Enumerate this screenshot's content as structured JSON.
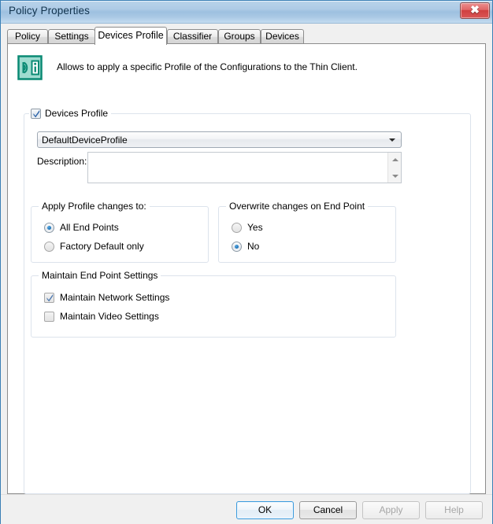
{
  "window": {
    "title": "Policy Properties",
    "close_label": "✕"
  },
  "tabs": [
    {
      "label": "Policy",
      "active": false
    },
    {
      "label": "Settings",
      "active": false
    },
    {
      "label": "Devices Profile",
      "active": true
    },
    {
      "label": "Classifier",
      "active": false
    },
    {
      "label": "Groups",
      "active": false
    },
    {
      "label": "Devices",
      "active": false
    }
  ],
  "header": {
    "icon": "thin-client-device-icon",
    "description": "Allows to apply a specific Profile of the Configurations to the Thin Client."
  },
  "devices_profile": {
    "legend": "Devices Profile",
    "enabled": true,
    "profile_combo": {
      "value": "DefaultDeviceProfile",
      "options": [
        "DefaultDeviceProfile"
      ]
    },
    "description": {
      "label": "Description:",
      "value": "",
      "placeholder": ""
    },
    "apply_changes": {
      "legend": "Apply Profile changes to:",
      "selected": "All End Points",
      "options": [
        {
          "label": "All End Points",
          "selected": true
        },
        {
          "label": "Factory Default only",
          "selected": false
        }
      ]
    },
    "overwrite_changes": {
      "legend": "Overwrite changes on End Point",
      "selected": "No",
      "options": [
        {
          "label": "Yes",
          "selected": false
        },
        {
          "label": "No",
          "selected": true
        }
      ]
    },
    "maintain_settings": {
      "legend": "Maintain End Point Settings",
      "options": [
        {
          "label": "Maintain Network Settings",
          "checked": true,
          "disabled": true
        },
        {
          "label": "Maintain Video Settings",
          "checked": false,
          "disabled": false
        }
      ]
    }
  },
  "buttons": [
    {
      "label": "OK",
      "style": "default",
      "enabled": true
    },
    {
      "label": "Cancel",
      "style": "normal",
      "enabled": true
    },
    {
      "label": "Apply",
      "style": "disabled",
      "enabled": false
    },
    {
      "label": "Help",
      "style": "disabled",
      "enabled": false
    }
  ],
  "colors": {
    "title_bar": "#aecbe6",
    "accent_icon": "#0a8a74",
    "close_button": "#cf4040",
    "default_button_border": "#3c9bdd",
    "groupbox_border": "#dce3ec"
  }
}
